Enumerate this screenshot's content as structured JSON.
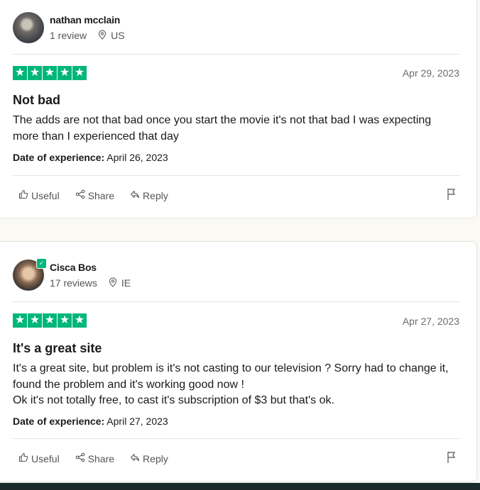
{
  "reviews": [
    {
      "name": "nathan mcclain",
      "review_count": "1 review",
      "country": "US",
      "verified": false,
      "stars": 5,
      "date": "Apr 29, 2023",
      "title": "Not bad",
      "body": [
        "The adds are not that bad once you start the movie it's not that bad I was expecting more than I experienced that day"
      ],
      "experience_label": "Date of experience:",
      "experience_date": "April 26, 2023",
      "actions": {
        "useful": "Useful",
        "share": "Share",
        "reply": "Reply"
      }
    },
    {
      "name": "Cisca Bos",
      "review_count": "17 reviews",
      "country": "IE",
      "verified": true,
      "stars": 5,
      "date": "Apr 27, 2023",
      "title": "It's a great site",
      "body": [
        "It's a great site, but problem is it's not casting to our television ? Sorry had to change it, found the problem and it's working good now !",
        "Ok it's not totally free, to cast it's subscription of $3 but that's ok."
      ],
      "experience_label": "Date of experience:",
      "experience_date": "April 27, 2023",
      "actions": {
        "useful": "Useful",
        "share": "Share",
        "reply": "Reply"
      }
    }
  ],
  "colors": {
    "star_green": "#00b67a",
    "page_bg": "#fbf9f4",
    "footer_bar": "#1c2a2c"
  },
  "icons": [
    "location-pin-icon",
    "star-icon",
    "thumbs-up-icon",
    "share-icon",
    "reply-icon",
    "flag-icon",
    "verified-icon"
  ]
}
